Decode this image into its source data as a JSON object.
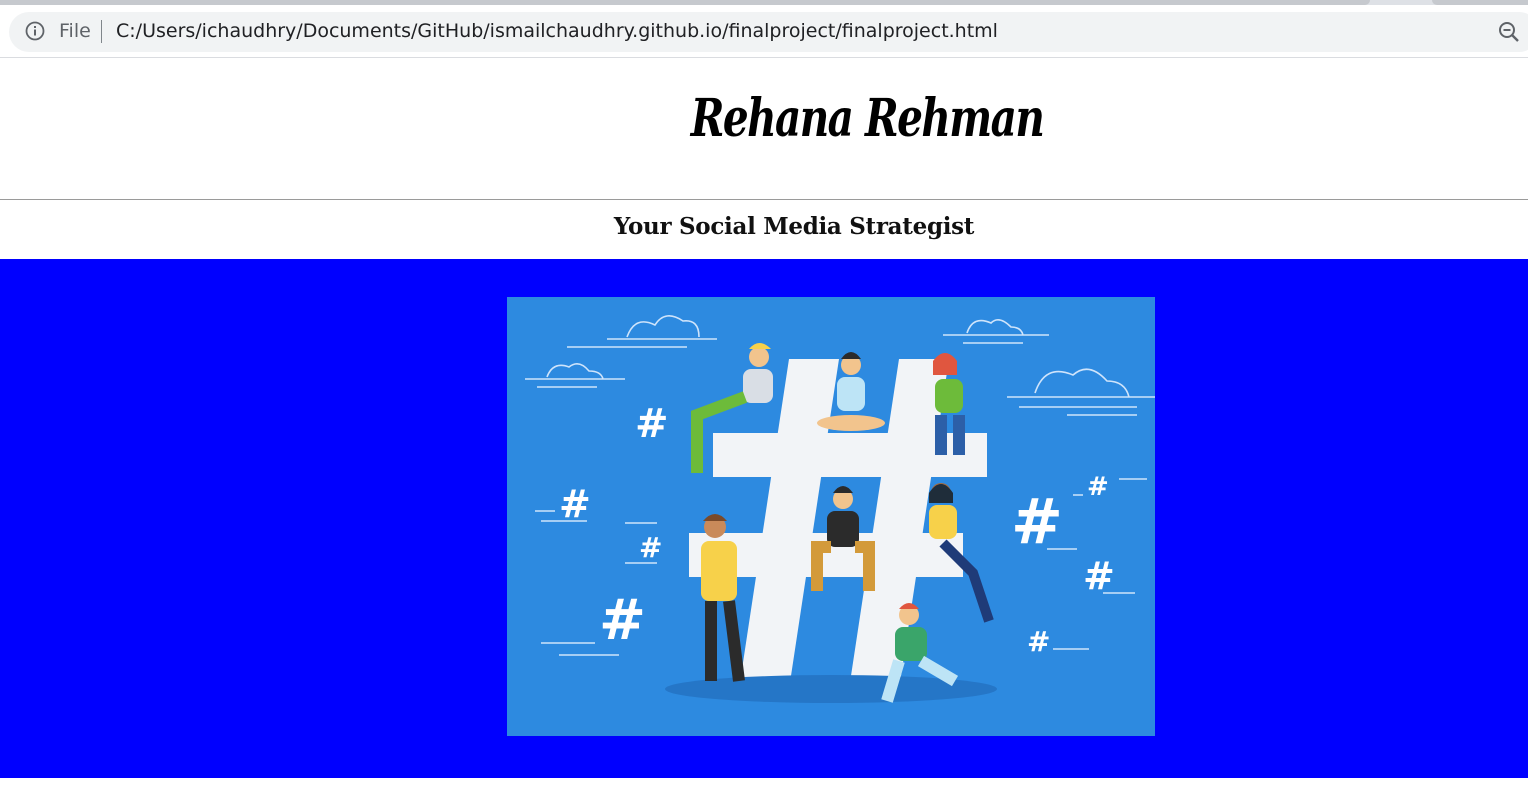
{
  "browser": {
    "file_label": "File",
    "url": "C:/Users/ichaudhry/Documents/GitHub/ismailchaudhry.github.io/finalproject/finalproject.html",
    "icons": [
      "info-icon",
      "zoom-out-icon"
    ]
  },
  "page": {
    "title": "Rehana Rehman",
    "tagline": "Your Social Media Strategist",
    "hero_background": "#0000ff",
    "image_background": "#2d8ae0"
  },
  "hero_image": {
    "glyphs": [
      "#",
      "#",
      "#",
      "#",
      "#",
      "#",
      "#",
      "#",
      "#"
    ]
  }
}
